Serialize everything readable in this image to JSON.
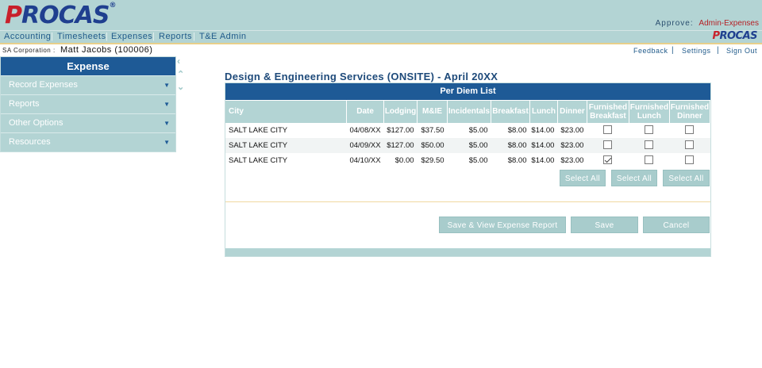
{
  "header": {
    "logo_text": "PROCAS",
    "approve_label": "Approve:",
    "approve_role": "Admin-Expenses"
  },
  "nav": {
    "items": [
      "Accounting",
      "Timesheets",
      "Expenses",
      "Reports",
      "T&E Admin"
    ],
    "logo_text": "PROCAS"
  },
  "subheader": {
    "corp_label": "SA Corporation :",
    "user": "Matt Jacobs (100006)",
    "links": [
      "Feedback",
      "Settings",
      "Sign Out"
    ]
  },
  "sidebar": {
    "title": "Expense",
    "items": [
      {
        "label": "Record Expenses"
      },
      {
        "label": "Reports"
      },
      {
        "label": "Other Options"
      },
      {
        "label": "Resources"
      }
    ]
  },
  "main": {
    "title": "Design & Engineering Services (ONSITE) - April 20XX",
    "panel_title": "Per Diem List",
    "columns": [
      "City",
      "Date",
      "Lodging",
      "M&IE",
      "Incidentals",
      "Breakfast",
      "Lunch",
      "Dinner",
      "Furnished Breakfast",
      "Furnished Lunch",
      "Furnished Dinner"
    ],
    "column_lines": [
      [
        "City"
      ],
      [
        "Date"
      ],
      [
        "Lodging"
      ],
      [
        "M&IE"
      ],
      [
        "Incidentals"
      ],
      [
        "Breakfast"
      ],
      [
        "Lunch"
      ],
      [
        "Dinner"
      ],
      [
        "Furnished",
        "Breakfast"
      ],
      [
        "Furnished",
        "Lunch"
      ],
      [
        "Furnished",
        "Dinner"
      ]
    ],
    "rows": [
      {
        "city": "SALT LAKE CITY",
        "date": "04/08/XX",
        "lodging": "$127.00",
        "mie": "$37.50",
        "incidentals": "$5.00",
        "breakfast": "$8.00",
        "lunch": "$14.00",
        "dinner": "$23.00",
        "furnished_breakfast": false,
        "furnished_lunch": false,
        "furnished_dinner": false
      },
      {
        "city": "SALT LAKE CITY",
        "date": "04/09/XX",
        "lodging": "$127.00",
        "mie": "$50.00",
        "incidentals": "$5.00",
        "breakfast": "$8.00",
        "lunch": "$14.00",
        "dinner": "$23.00",
        "furnished_breakfast": false,
        "furnished_lunch": false,
        "furnished_dinner": false
      },
      {
        "city": "SALT LAKE CITY",
        "date": "04/10/XX",
        "lodging": "$0.00",
        "mie": "$29.50",
        "incidentals": "$5.00",
        "breakfast": "$8.00",
        "lunch": "$14.00",
        "dinner": "$23.00",
        "furnished_breakfast": true,
        "furnished_lunch": false,
        "furnished_dinner": false
      }
    ],
    "select_all_label": "Select All",
    "buttons": {
      "save_view": "Save & View Expense Report",
      "save": "Save",
      "cancel": "Cancel"
    }
  },
  "colors": {
    "header_bg": "#b3d4d4",
    "primary_blue": "#1e5a96",
    "logo_red": "#c8202b",
    "accent_gold": "#e8cf8a"
  }
}
